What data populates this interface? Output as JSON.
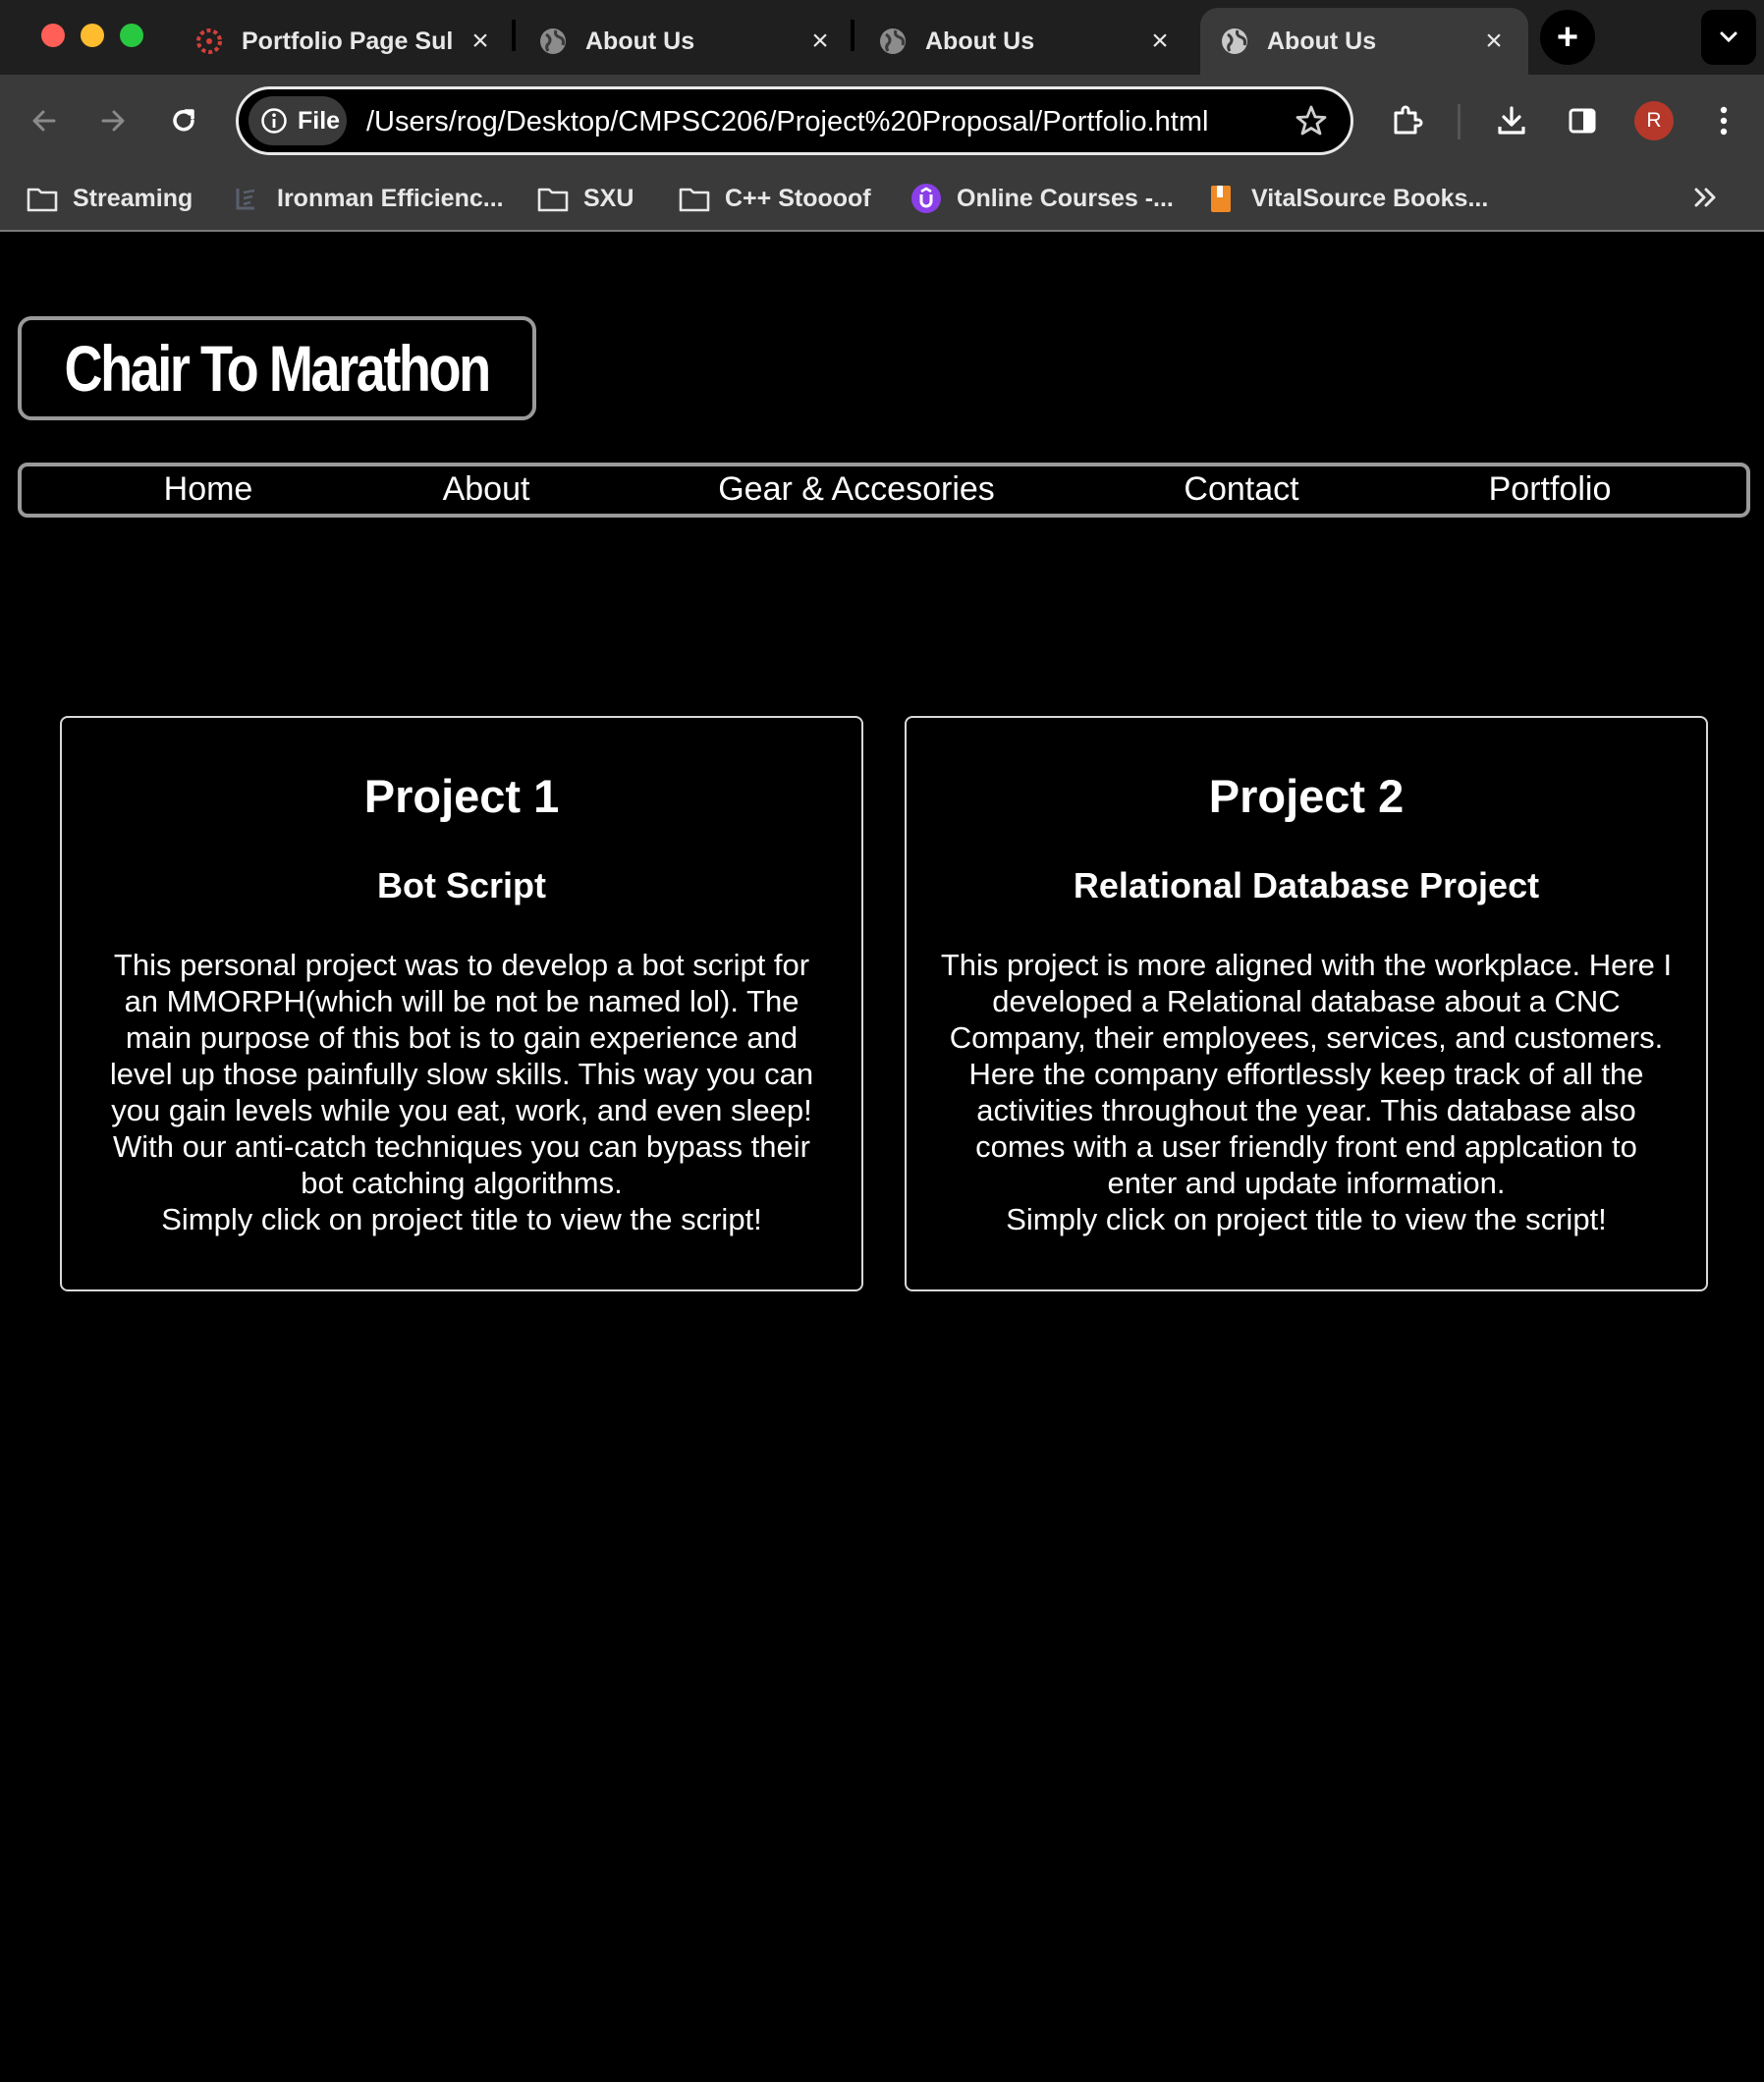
{
  "browser": {
    "tabs": [
      {
        "title": "Portfolio Page Sul",
        "icon": "canvas-logo-icon",
        "active": false
      },
      {
        "title": "About Us",
        "icon": "globe-icon",
        "active": false
      },
      {
        "title": "About Us",
        "icon": "globe-icon",
        "active": false
      },
      {
        "title": "About Us",
        "icon": "globe-icon",
        "active": true
      }
    ],
    "address_bar": {
      "chip_label": "File",
      "url": "/Users/rog/Desktop/CMPSC206/Project%20Proposal/Portfolio.html"
    },
    "profile_initial": "R",
    "bookmarks": [
      {
        "label": "Streaming",
        "icon": "folder-icon"
      },
      {
        "label": "Ironman Efficienc...",
        "icon": "ironman-logo-icon"
      },
      {
        "label": "SXU",
        "icon": "folder-icon"
      },
      {
        "label": "C++ Stoooof",
        "icon": "folder-icon"
      },
      {
        "label": "Online Courses -...",
        "icon": "udemy-logo-icon"
      },
      {
        "label": "VitalSource Books...",
        "icon": "vitalsource-logo-icon"
      }
    ]
  },
  "site": {
    "logo_text": "Chair To Marathon",
    "nav": [
      "Home",
      "About",
      "Gear & Accesories",
      "Contact",
      "Portfolio"
    ],
    "projects": [
      {
        "heading": "Project 1",
        "subtitle": "Bot Script",
        "lines": [
          "This personal project was to develop a bot script for",
          "an MMORPH(which will be not be named lol). The",
          "main purpose of this bot is to gain experience and",
          "level up those painfully slow skills. This way you can",
          "you gain levels while you eat, work, and even sleep!",
          "With our anti-catch techniques you can bypass their",
          "bot catching algorithms.",
          "Simply click on project title to view the script!"
        ]
      },
      {
        "heading": "Project 2",
        "subtitle": "Relational Database Project",
        "lines": [
          "This project is more aligned with the workplace. Here I",
          "developed a Relational database about a CNC",
          "Company, their employees, services, and customers.",
          "Here the company effortlessly keep track of all the",
          "activities throughout the year. This database also",
          "comes with a user friendly front end applcation to",
          "enter and update information.",
          "Simply click on project title to view the script!"
        ]
      }
    ]
  },
  "colors": {
    "page_background": "#000000",
    "chrome_dark": "#1f1f1f",
    "chrome_toolbar": "#3a3a3a",
    "border_gray": "#9a9a9a",
    "avatar": "#b5382a"
  }
}
